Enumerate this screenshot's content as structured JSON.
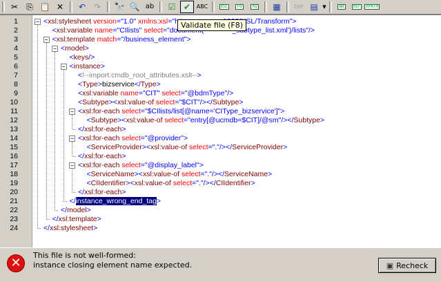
{
  "toolbar": {
    "buttons": [
      "cut-icon",
      "copy-icon",
      "paste-icon",
      "delete-icon",
      "undo-icon",
      "redo-icon",
      "find-icon",
      "find-next-icon",
      "replace-icon",
      "check-wellformed-icon",
      "validate-icon",
      "spellcheck-icon",
      "xsl-transform-icon",
      "xsl-fo-icon",
      "xquery-icon",
      "grid-view-icon",
      "def-icon",
      "browser-icon",
      "webdav-icon",
      "ref-icon",
      "xpath-icon"
    ],
    "mini_labels": {
      "xsl": "XSL",
      "fo": "FO",
      "xq": "XQ",
      "wb": "WB",
      "ref": "REF",
      "xpath": "XPATH"
    }
  },
  "tooltip": "Validate file (F8)",
  "editor": {
    "lines": [
      {
        "n": "1",
        "indent": 0,
        "parts": [
          [
            "p",
            "<"
          ],
          [
            "t",
            "xsl:stylesheet"
          ],
          [
            "a",
            " version"
          ],
          [
            "p",
            "="
          ],
          [
            "v",
            "\"1.0\""
          ],
          [
            "a",
            " xmlns:xsl"
          ],
          [
            "p",
            "="
          ],
          [
            "v",
            "\"http"
          ],
          [
            "t",
            "                  "
          ],
          [
            "v",
            "1999/XSL/Transform\""
          ],
          [
            "p",
            ">"
          ]
        ]
      },
      {
        "n": "2",
        "indent": 1,
        "parts": [
          [
            "p",
            "<"
          ],
          [
            "t",
            "xsl:variable"
          ],
          [
            "a",
            " name"
          ],
          [
            "p",
            "="
          ],
          [
            "v",
            "\"CIlists\""
          ],
          [
            "a",
            " select"
          ],
          [
            "p",
            "="
          ],
          [
            "v",
            "\"document("
          ],
          [
            "t",
            "              "
          ],
          [
            "v",
            "_subtype_list.xml')/lists\""
          ],
          [
            "p",
            "/>"
          ]
        ]
      },
      {
        "n": "3",
        "indent": 1,
        "parts": [
          [
            "p",
            "<"
          ],
          [
            "t",
            "xsl:template"
          ],
          [
            "a",
            " match"
          ],
          [
            "p",
            "="
          ],
          [
            "v",
            "\"/business_element\""
          ],
          [
            "p",
            ">"
          ]
        ]
      },
      {
        "n": "4",
        "indent": 2,
        "parts": [
          [
            "p",
            "<"
          ],
          [
            "t",
            "model"
          ],
          [
            "p",
            ">"
          ]
        ]
      },
      {
        "n": "5",
        "indent": 3,
        "parts": [
          [
            "p",
            "<"
          ],
          [
            "t",
            "keys"
          ],
          [
            "p",
            "/>"
          ]
        ]
      },
      {
        "n": "6",
        "indent": 3,
        "parts": [
          [
            "p",
            "<"
          ],
          [
            "t",
            "instance"
          ],
          [
            "p",
            ">"
          ]
        ]
      },
      {
        "n": "7",
        "indent": 4,
        "parts": [
          [
            "p",
            "<"
          ],
          [
            "c",
            "!--import:cmdb_root_attributes.xslt--"
          ],
          [
            "p",
            ">"
          ]
        ]
      },
      {
        "n": "8",
        "indent": 4,
        "parts": [
          [
            "p",
            "<"
          ],
          [
            "t",
            "Type"
          ],
          [
            "p",
            ">"
          ],
          [
            "x",
            "bizservice"
          ],
          [
            "p",
            "</"
          ],
          [
            "t",
            "Type"
          ],
          [
            "p",
            ">"
          ]
        ]
      },
      {
        "n": "9",
        "indent": 4,
        "parts": [
          [
            "p",
            "<"
          ],
          [
            "t",
            "xsl:variable"
          ],
          [
            "a",
            " name"
          ],
          [
            "p",
            "="
          ],
          [
            "v",
            "\"CIT\""
          ],
          [
            "a",
            " select"
          ],
          [
            "p",
            "="
          ],
          [
            "v",
            "\"@bdmType\""
          ],
          [
            "p",
            "/>"
          ]
        ]
      },
      {
        "n": "10",
        "indent": 4,
        "parts": [
          [
            "p",
            "<"
          ],
          [
            "t",
            "Subtype"
          ],
          [
            "p",
            "><"
          ],
          [
            "t",
            "xsl:value-of"
          ],
          [
            "a",
            " select"
          ],
          [
            "p",
            "="
          ],
          [
            "v",
            "\"$CIT\""
          ],
          [
            "p",
            "/></"
          ],
          [
            "t",
            "Subtype"
          ],
          [
            "p",
            ">"
          ]
        ]
      },
      {
        "n": "11",
        "indent": 4,
        "parts": [
          [
            "p",
            "<"
          ],
          [
            "t",
            "xsl:for-each"
          ],
          [
            "a",
            " select"
          ],
          [
            "p",
            "="
          ],
          [
            "v",
            "\"$CIlists/list[@name='CIType_bizservice']\""
          ],
          [
            "p",
            ">"
          ]
        ]
      },
      {
        "n": "12",
        "indent": 5,
        "parts": [
          [
            "p",
            "<"
          ],
          [
            "t",
            "Subtype"
          ],
          [
            "p",
            "><"
          ],
          [
            "t",
            "xsl:value-of"
          ],
          [
            "a",
            " select"
          ],
          [
            "p",
            "="
          ],
          [
            "v",
            "\"entry[@ucmdb=$CIT]/@sm\""
          ],
          [
            "p",
            "/></"
          ],
          [
            "t",
            "Subtype"
          ],
          [
            "p",
            ">"
          ]
        ]
      },
      {
        "n": "13",
        "indent": 4,
        "parts": [
          [
            "p",
            "</"
          ],
          [
            "t",
            "xsl:for-each"
          ],
          [
            "p",
            ">"
          ]
        ]
      },
      {
        "n": "14",
        "indent": 4,
        "parts": [
          [
            "p",
            "<"
          ],
          [
            "t",
            "xsl:for-each"
          ],
          [
            "a",
            " select"
          ],
          [
            "p",
            "="
          ],
          [
            "v",
            "\"@provider\""
          ],
          [
            "p",
            ">"
          ]
        ]
      },
      {
        "n": "15",
        "indent": 5,
        "parts": [
          [
            "p",
            "<"
          ],
          [
            "t",
            "ServiceProvider"
          ],
          [
            "p",
            "><"
          ],
          [
            "t",
            "xsl:value-of"
          ],
          [
            "a",
            " select"
          ],
          [
            "p",
            "="
          ],
          [
            "v",
            "\".\""
          ],
          [
            "p",
            "/></"
          ],
          [
            "t",
            "ServiceProvider"
          ],
          [
            "p",
            ">"
          ]
        ]
      },
      {
        "n": "16",
        "indent": 4,
        "parts": [
          [
            "p",
            "</"
          ],
          [
            "t",
            "xsl:for-each"
          ],
          [
            "p",
            ">"
          ]
        ]
      },
      {
        "n": "17",
        "indent": 4,
        "parts": [
          [
            "p",
            "<"
          ],
          [
            "t",
            "xsl:for-each"
          ],
          [
            "a",
            " select"
          ],
          [
            "p",
            "="
          ],
          [
            "v",
            "\"@display_label\""
          ],
          [
            "p",
            ">"
          ]
        ]
      },
      {
        "n": "18",
        "indent": 5,
        "parts": [
          [
            "p",
            "<"
          ],
          [
            "t",
            "ServiceName"
          ],
          [
            "p",
            "><"
          ],
          [
            "t",
            "xsl:value-of"
          ],
          [
            "a",
            " select"
          ],
          [
            "p",
            "="
          ],
          [
            "v",
            "\".\""
          ],
          [
            "p",
            "/></"
          ],
          [
            "t",
            "ServiceName"
          ],
          [
            "p",
            ">"
          ]
        ]
      },
      {
        "n": "19",
        "indent": 5,
        "parts": [
          [
            "p",
            "<"
          ],
          [
            "t",
            "CIIdentifier"
          ],
          [
            "p",
            "><"
          ],
          [
            "t",
            "xsl:value-of"
          ],
          [
            "a",
            " select"
          ],
          [
            "p",
            "="
          ],
          [
            "v",
            "\".\""
          ],
          [
            "p",
            "/></"
          ],
          [
            "t",
            "CIIdentifier"
          ],
          [
            "p",
            ">"
          ]
        ]
      },
      {
        "n": "20",
        "indent": 4,
        "parts": [
          [
            "p",
            "</"
          ],
          [
            "t",
            "xsl:for-each"
          ],
          [
            "p",
            ">"
          ]
        ]
      },
      {
        "n": "21",
        "indent": 3,
        "parts": [
          [
            "p",
            "</"
          ],
          [
            "s",
            "instance_wrong_end_tag"
          ],
          [
            "p",
            ">"
          ]
        ]
      },
      {
        "n": "22",
        "indent": 2,
        "parts": [
          [
            "p",
            "</"
          ],
          [
            "t",
            "model"
          ],
          [
            "p",
            ">"
          ]
        ]
      },
      {
        "n": "23",
        "indent": 1,
        "parts": [
          [
            "p",
            "</"
          ],
          [
            "t",
            "xsl:template"
          ],
          [
            "p",
            ">"
          ]
        ]
      },
      {
        "n": "24",
        "indent": 0,
        "parts": [
          [
            "p",
            "</"
          ],
          [
            "t",
            "xsl:stylesheet"
          ],
          [
            "p",
            ">"
          ]
        ]
      }
    ]
  },
  "messages": {
    "line1": "This file is not well-formed:",
    "line2": "instance closing element name expected.",
    "recheck_label": "Recheck",
    "status_color": "#e01010"
  }
}
